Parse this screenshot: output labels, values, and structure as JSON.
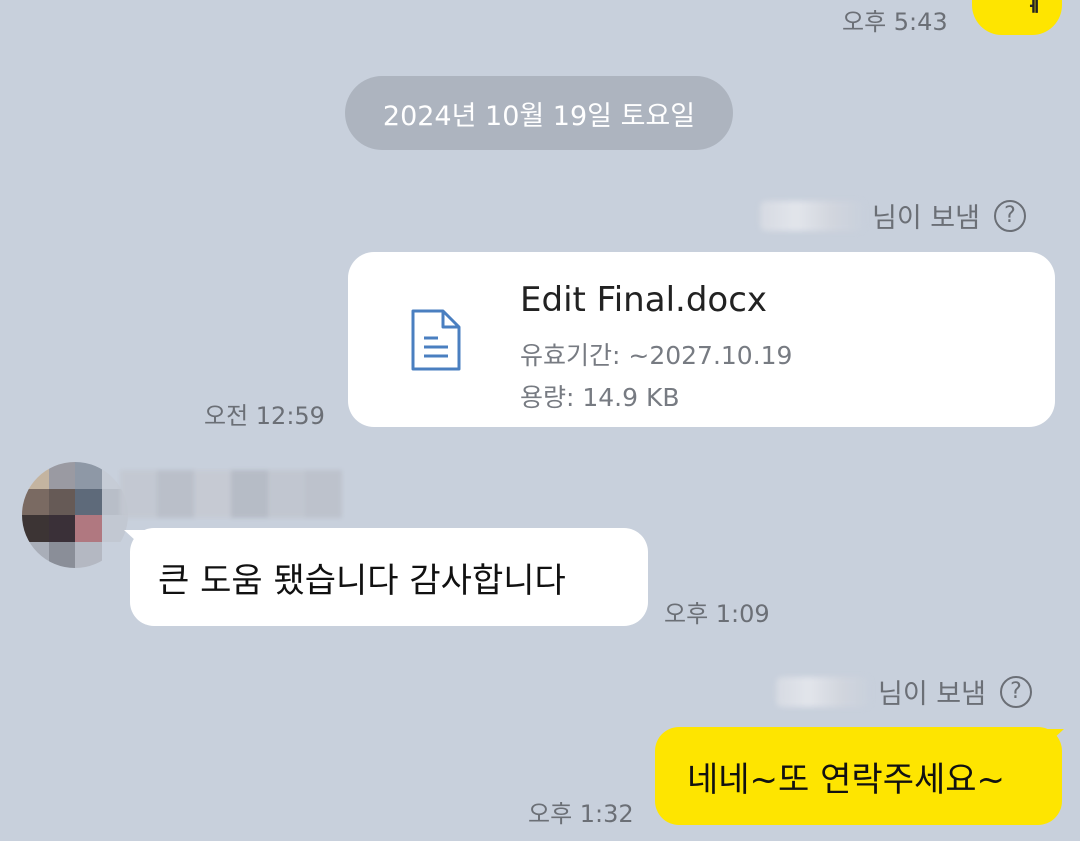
{
  "top_message": {
    "time": "오후 5:43",
    "partial_text": "ᅦ"
  },
  "date_divider": "2024년 10월 19일 토요일",
  "file_message": {
    "sender_suffix": "님이 보냄",
    "help_symbol": "?",
    "file_name": "Edit Final.docx",
    "expiry": "유효기간: ~2027.10.19",
    "size": "용량: 14.9 KB",
    "time": "오전 12:59",
    "icon": "document-icon"
  },
  "incoming_message": {
    "text": "큰 도움 됐습니다 감사합니다",
    "time": "오후 1:09"
  },
  "outgoing_message": {
    "sender_suffix": "님이 보냄",
    "help_symbol": "?",
    "text": "네네~또 연락주세요~",
    "time": "오후 1:32"
  },
  "colors": {
    "background": "#c8d0dc",
    "my_bubble": "#fee500",
    "peer_bubble": "#ffffff",
    "date_pill": "#adb4bf",
    "doc_icon": "#4a7fc0"
  }
}
